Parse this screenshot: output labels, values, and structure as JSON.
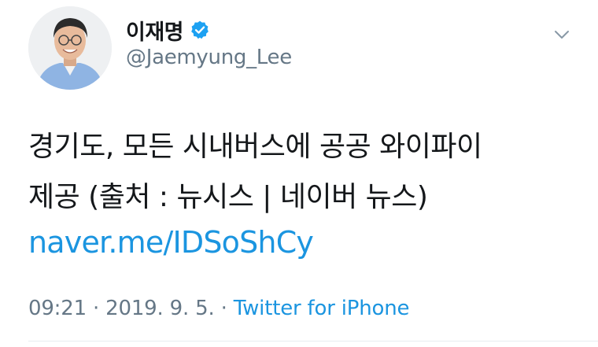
{
  "user": {
    "display_name": "이재명",
    "handle": "@Jaemyung_Lee",
    "verified": true
  },
  "tweet": {
    "text_lines": [
      "경기도, 모든 시내버스에 공공 와이파이",
      "제공 (출처 : 뉴시스 | 네이버 뉴스)"
    ],
    "link": "naver.me/IDSoShCy",
    "time": "09:21",
    "separator": " · ",
    "date": "2019. 9. 5.",
    "source": "Twitter for iPhone"
  },
  "colors": {
    "text": "#14171a",
    "secondary": "#657786",
    "link": "#1b95e0",
    "verified": "#1da1f2"
  },
  "icons": {
    "verified": "verified-badge-icon",
    "menu": "chevron-down-icon"
  }
}
